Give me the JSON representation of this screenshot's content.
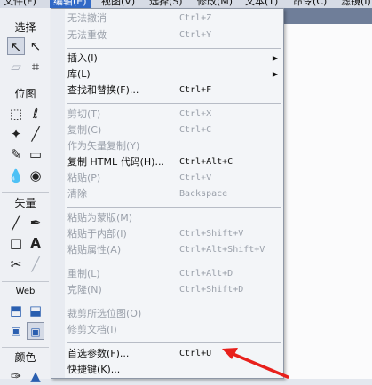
{
  "menubar": {
    "items": [
      "文件(F)",
      "编辑(E)",
      "视图(V)",
      "选择(S)",
      "修改(M)",
      "文本(T)",
      "命令(C)",
      "滤镜(I)"
    ]
  },
  "tools": {
    "sections": [
      "选择",
      "位图",
      "矢量",
      "Web",
      "颜色"
    ]
  },
  "menu": {
    "items": [
      {
        "label": "无法撤消",
        "shortcut": "Ctrl+Z",
        "disabled": true
      },
      {
        "label": "无法重做",
        "shortcut": "Ctrl+Y",
        "disabled": true
      },
      {
        "label": "插入(I)",
        "shortcut": "",
        "disabled": false,
        "submenu": true
      },
      {
        "label": "库(L)",
        "shortcut": "",
        "disabled": false,
        "submenu": true
      },
      {
        "label": "查找和替换(F)...",
        "shortcut": "Ctrl+F",
        "disabled": false
      },
      {
        "label": "剪切(T)",
        "shortcut": "Ctrl+X",
        "disabled": true
      },
      {
        "label": "复制(C)",
        "shortcut": "Ctrl+C",
        "disabled": true
      },
      {
        "label": "作为矢量复制(Y)",
        "shortcut": "",
        "disabled": true
      },
      {
        "label": "复制 HTML 代码(H)...",
        "shortcut": "Ctrl+Alt+C",
        "disabled": false
      },
      {
        "label": "粘贴(P)",
        "shortcut": "Ctrl+V",
        "disabled": true
      },
      {
        "label": "清除",
        "shortcut": "Backspace",
        "disabled": true
      },
      {
        "label": "粘贴为蒙版(M)",
        "shortcut": "",
        "disabled": true
      },
      {
        "label": "粘贴于内部(I)",
        "shortcut": "Ctrl+Shift+V",
        "disabled": true
      },
      {
        "label": "粘贴属性(A)",
        "shortcut": "Ctrl+Alt+Shift+V",
        "disabled": true
      },
      {
        "label": "重制(L)",
        "shortcut": "Ctrl+Alt+D",
        "disabled": true
      },
      {
        "label": "克隆(N)",
        "shortcut": "Ctrl+Shift+D",
        "disabled": true
      },
      {
        "label": "裁剪所选位图(O)",
        "shortcut": "",
        "disabled": true
      },
      {
        "label": "修剪文档(I)",
        "shortcut": "",
        "disabled": true
      },
      {
        "label": "首选参数(F)...",
        "shortcut": "Ctrl+U",
        "disabled": false
      },
      {
        "label": "快捷键(K)...",
        "shortcut": "",
        "disabled": false
      }
    ]
  },
  "colors": {
    "accent": "#3169c6",
    "arrow": "#e8201c"
  }
}
